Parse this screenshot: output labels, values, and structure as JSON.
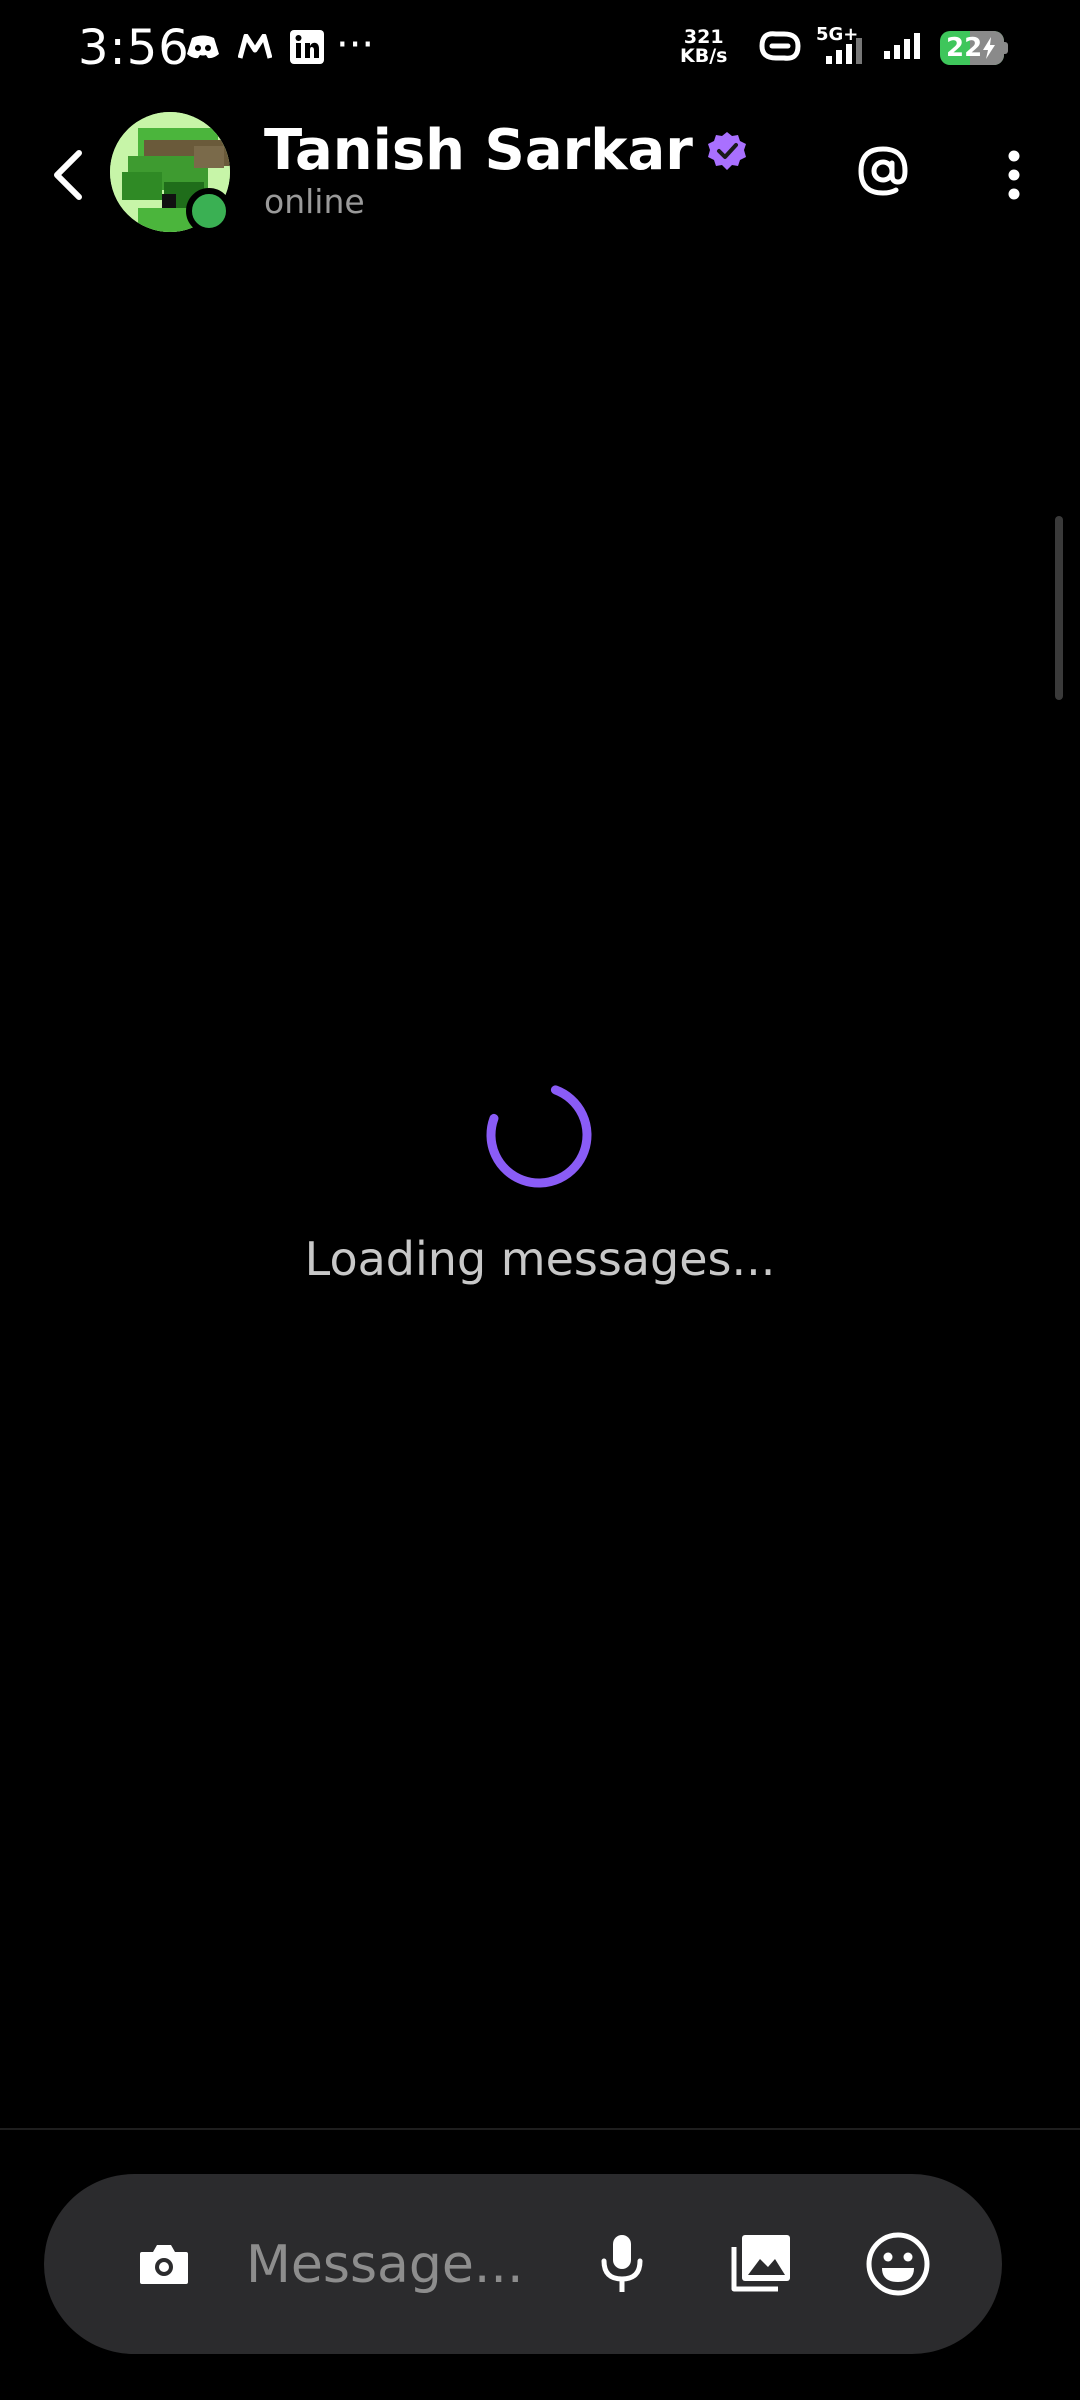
{
  "status_bar": {
    "time": "3:56",
    "net_speed_value": "321",
    "net_speed_unit": "KB/s",
    "network_type": "5G+",
    "battery_level": "22",
    "battery_color": "#3ec65b"
  },
  "header": {
    "contact_name": "Tanish Sarkar",
    "contact_status": "online",
    "verified_color": "#a970ff"
  },
  "loading": {
    "text": "Loading messages...",
    "spinner_color": "#8a5cf6"
  },
  "composer": {
    "placeholder": "Message..."
  }
}
